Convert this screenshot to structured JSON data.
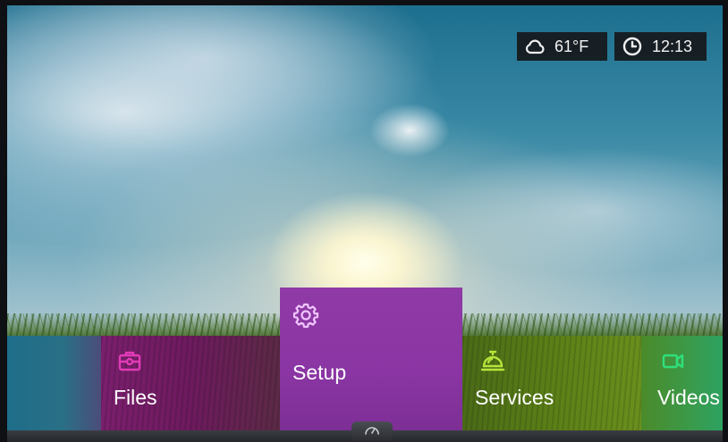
{
  "status": {
    "weather": {
      "icon": "cloud-icon",
      "temperature": "61°F"
    },
    "clock": {
      "icon": "clock-icon",
      "time": "12:13"
    }
  },
  "menu": {
    "items": [
      {
        "id": "files",
        "label": "Files",
        "icon": "briefcase-icon",
        "color": "#e23bb8"
      },
      {
        "id": "setup",
        "label": "Setup",
        "icon": "gear-icon",
        "color": "#e8b7f5",
        "selected": true
      },
      {
        "id": "services",
        "label": "Services",
        "icon": "service-bell-icon",
        "color": "#b7e43a"
      },
      {
        "id": "videos",
        "label": "Videos",
        "icon": "video-camera-icon",
        "color": "#2ee07c"
      }
    ]
  },
  "bottom_bar": {
    "options_icon": "gauge-icon"
  },
  "colors": {
    "files_tile": "#7a1f6d",
    "setup_tile": "#8f3aa6",
    "services_tile": "#5b7f17",
    "videos_tile": "#3a9a4a",
    "widget_bg": "#16181b"
  }
}
